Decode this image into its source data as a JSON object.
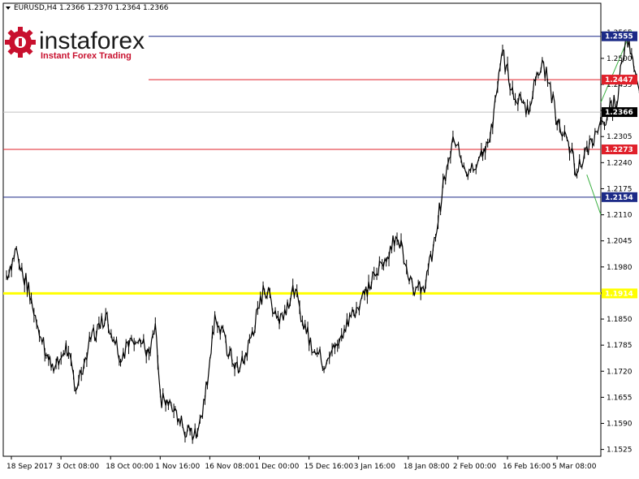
{
  "header": {
    "symbol_line": "EURUSD,H4  1.2366 1.2370 1.2364 1.2366"
  },
  "logo": {
    "brand": "instaforex",
    "tagline": "Instant Forex Trading"
  },
  "colors": {
    "line_blue": "#1c2a87",
    "line_red": "#e0202a",
    "line_gray": "#c0c0c0",
    "line_yellow": "#ffff00",
    "trend_green": "#3cb043",
    "candle": "#000000",
    "brand_red": "#c8102e"
  },
  "chart_data": {
    "type": "line",
    "title": "EURUSD,H4",
    "ylim": [
      1.2488,
      1.2636
    ],
    "y_ticks": [
      "1.2565",
      "1.2500",
      "1.2435",
      "1.2370",
      "1.2305",
      "1.2240",
      "1.2175",
      "1.2110",
      "1.2045",
      "1.1980",
      "1.1915",
      "1.1850",
      "1.1785",
      "1.1720",
      "1.1655",
      "1.1590",
      "1.1525"
    ],
    "y_tick_values": [
      1.2565,
      1.25,
      1.2435,
      1.237,
      1.2305,
      1.224,
      1.2175,
      1.211,
      1.2045,
      1.198,
      1.1915,
      1.185,
      1.1785,
      1.172,
      1.1655,
      1.159,
      1.1525
    ],
    "x_ticks": [
      "18 Sep 2017",
      "3 Oct 08:00",
      "18 Oct 00:00",
      "1 Nov 16:00",
      "16 Nov 08:00",
      "1 Dec 00:00",
      "15 Dec 16:00",
      "3 Jan 16:00",
      "18 Jan 08:00",
      "2 Feb 00:00",
      "16 Feb 16:00",
      "5 Mar 08:00"
    ],
    "x_tick_index": [
      0,
      1,
      2,
      3,
      4,
      5,
      6,
      7,
      8,
      9,
      10,
      11
    ],
    "price_path": [
      [
        0.0,
        1.196
      ],
      [
        0.2,
        1.202
      ],
      [
        0.5,
        1.19
      ],
      [
        0.8,
        1.176
      ],
      [
        1.0,
        1.173
      ],
      [
        1.2,
        1.178
      ],
      [
        1.4,
        1.168
      ],
      [
        1.7,
        1.18
      ],
      [
        2.0,
        1.186
      ],
      [
        2.3,
        1.176
      ],
      [
        2.6,
        1.181
      ],
      [
        2.9,
        1.176
      ],
      [
        3.0,
        1.183
      ],
      [
        3.1,
        1.165
      ],
      [
        3.4,
        1.162
      ],
      [
        3.6,
        1.157
      ],
      [
        3.8,
        1.156
      ],
      [
        4.0,
        1.165
      ],
      [
        4.2,
        1.186
      ],
      [
        4.5,
        1.176
      ],
      [
        4.7,
        1.172
      ],
      [
        4.9,
        1.179
      ],
      [
        5.2,
        1.193
      ],
      [
        5.5,
        1.185
      ],
      [
        5.8,
        1.192
      ],
      [
        6.1,
        1.18
      ],
      [
        6.4,
        1.174
      ],
      [
        6.7,
        1.18
      ],
      [
        7.0,
        1.187
      ],
      [
        7.3,
        1.193
      ],
      [
        7.6,
        1.2
      ],
      [
        7.9,
        1.206
      ],
      [
        8.2,
        1.193
      ],
      [
        8.4,
        1.192
      ],
      [
        8.6,
        1.202
      ],
      [
        8.8,
        1.218
      ],
      [
        9.0,
        1.229
      ],
      [
        9.3,
        1.222
      ],
      [
        9.6,
        1.226
      ],
      [
        9.8,
        1.234
      ],
      [
        10.0,
        1.251
      ],
      [
        10.2,
        1.242
      ],
      [
        10.5,
        1.237
      ],
      [
        10.8,
        1.25
      ],
      [
        11.1,
        1.235
      ],
      [
        11.3,
        1.229
      ],
      [
        11.5,
        1.222
      ],
      [
        11.7,
        1.227
      ],
      [
        12.0,
        1.233
      ],
      [
        12.3,
        1.24
      ],
      [
        12.5,
        1.256
      ],
      [
        12.7,
        1.246
      ],
      [
        13.0,
        1.236
      ],
      [
        13.3,
        1.232
      ],
      [
        13.6,
        1.226
      ],
      [
        13.9,
        1.226
      ],
      [
        14.1,
        1.217
      ],
      [
        14.3,
        1.227
      ],
      [
        14.6,
        1.234
      ],
      [
        14.9,
        1.245
      ],
      [
        15.2,
        1.242
      ],
      [
        15.4,
        1.229
      ],
      [
        15.6,
        1.233
      ],
      [
        15.9,
        1.24
      ],
      [
        16.1,
        1.2366
      ]
    ],
    "horizontal_levels": [
      {
        "value": 1.2555,
        "label": "1.2555",
        "color": "#1c2a87",
        "tag_text_color": "#ffffff"
      },
      {
        "value": 1.2447,
        "label": "1.2447",
        "color": "#e0202a",
        "tag_text_color": "#ffffff"
      },
      {
        "value": 1.2366,
        "label": "1.2366",
        "color": "#c0c0c0",
        "tag_text_color": "#ffffff",
        "tag_fill": "#000000"
      },
      {
        "value": 1.2273,
        "label": "1.2273",
        "color": "#e0202a",
        "tag_text_color": "#ffffff"
      },
      {
        "value": 1.2154,
        "label": "1.2154",
        "color": "#1c2a87",
        "tag_text_color": "#ffffff"
      },
      {
        "value": 1.1914,
        "label": "1.1914",
        "color": "#ffff00",
        "tag_text_color": "#ffffff",
        "thick": true
      }
    ],
    "trend_lines": [
      {
        "from": [
          12.5,
          1.257
        ],
        "to": [
          16.3,
          1.239
        ]
      },
      {
        "from": [
          11.6,
          1.221
        ],
        "to": [
          16.3,
          1.211
        ]
      }
    ],
    "grid": false,
    "legend": "none"
  }
}
